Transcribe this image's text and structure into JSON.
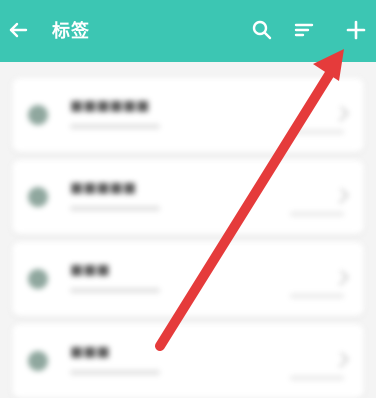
{
  "header": {
    "title": "标签",
    "icons": {
      "back": "back-arrow-icon",
      "search": "search-icon",
      "sort": "sort-icon",
      "add": "plus-icon"
    }
  },
  "tags": [
    {
      "name": "■■■■■■"
    },
    {
      "name": "■■■■■"
    },
    {
      "name": "■■■"
    },
    {
      "name": "■■■"
    }
  ],
  "colors": {
    "header_bg": "#3cc6b3",
    "background": "#f4f4f4",
    "card_bg": "#ffffff",
    "dot": "#8fa79e",
    "arrow": "#e53b3b"
  }
}
